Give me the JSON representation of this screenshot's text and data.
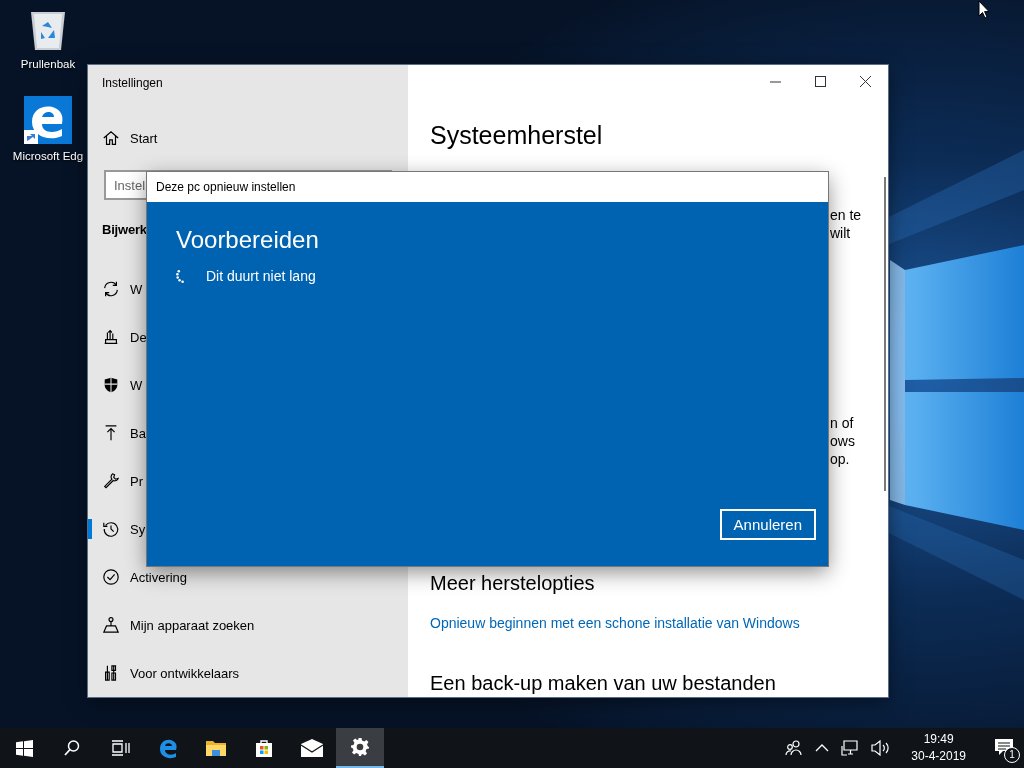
{
  "desktop_icons": [
    {
      "kind": "recycle-bin",
      "label": "Prullenbak"
    },
    {
      "kind": "edge",
      "label": "Microsoft Edg"
    }
  ],
  "settings_window": {
    "title": "Instellingen",
    "home": {
      "label": "Start"
    },
    "search": {
      "placeholder": "Instel"
    },
    "section": "Bijwerk",
    "nav_items": [
      {
        "kind": "sync",
        "label": "W",
        "selected": false
      },
      {
        "kind": "delivery",
        "label": "De",
        "selected": false
      },
      {
        "kind": "shield",
        "label": "W",
        "selected": false
      },
      {
        "kind": "upload",
        "label": "Ba",
        "selected": false
      },
      {
        "kind": "wrench",
        "label": "Pr",
        "selected": false
      },
      {
        "kind": "history",
        "label": "Sy",
        "selected": true
      },
      {
        "kind": "check",
        "label": "Activering",
        "selected": false
      },
      {
        "kind": "locate",
        "label": "Mijn apparaat zoeken",
        "selected": false
      },
      {
        "kind": "dev",
        "label": "Voor ontwikkelaars",
        "selected": false
      }
    ],
    "page_title": "Systeemherstel",
    "text_fragments": [
      [
        "en te",
        "wilt"
      ],
      [
        "n of",
        "ows",
        "op."
      ]
    ],
    "more_heading": "Meer herstelopties",
    "link": "Opnieuw beginnen met een schone installatie van Windows",
    "backup_heading": "Een back-up maken van uw bestanden"
  },
  "dialog": {
    "title": "Deze pc opnieuw instellen",
    "heading": "Voorbereiden",
    "status": "Dit duurt niet lang",
    "button": "Annuleren"
  },
  "taskbar": {
    "apps": [
      {
        "kind": "start",
        "selected": false
      },
      {
        "kind": "search",
        "selected": false
      },
      {
        "kind": "taskview",
        "selected": false
      },
      {
        "kind": "edge",
        "selected": false
      },
      {
        "kind": "explorer",
        "selected": false
      },
      {
        "kind": "store",
        "selected": false
      },
      {
        "kind": "mail",
        "selected": false
      },
      {
        "kind": "settings",
        "selected": true
      }
    ],
    "time": "19:49",
    "date": "30-4-2019",
    "notification_count": "1"
  }
}
